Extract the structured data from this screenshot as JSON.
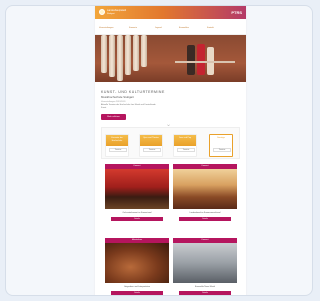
{
  "header": {
    "logo_line1": "Landeshauptstadt",
    "logo_line2": "Stuttgart",
    "brand": "PTRS"
  },
  "nav": {
    "items": [
      "Veranstaltungen",
      "Konzerte",
      "Jugend",
      "Ensembles",
      "Kontakt"
    ]
  },
  "title": {
    "main": "KUNST- UND KULTURTERMINE",
    "sub": "Musikhochschule Stuttgart",
    "date": "Veranstaltungen 2019/2020"
  },
  "intro": {
    "text": "Aktuelle Termine der Hochschule fuer Musik und Darstellende Kunst.",
    "button": "Mehr erfahren"
  },
  "calendar": {
    "boxes": [
      {
        "label": "Konzerte der Hochschule",
        "button": "Termine"
      },
      {
        "label": "Oper und Theater",
        "button": "Termine"
      },
      {
        "label": "Jazz und Pop",
        "button": "Termine"
      },
      {
        "label": "Sonstige",
        "button": "Termine"
      }
    ]
  },
  "tiles": [
    {
      "head": "Konzert",
      "caption": "Orchesterkonzert im Konzertsaal",
      "button": "Details"
    },
    {
      "head": "Konzert",
      "caption": "Liederabend im Kammermusiksaal",
      "button": "Details"
    },
    {
      "head": "Meisterkurs",
      "caption": "Geigenbau und Interpretation",
      "button": "Details"
    },
    {
      "head": "Konzert",
      "caption": "Ensemble Neue Musik",
      "button": "Details"
    }
  ],
  "colors": {
    "accent": "#b5155e",
    "gradient_start": "#f2a63b",
    "gradient_end": "#b43a68"
  }
}
